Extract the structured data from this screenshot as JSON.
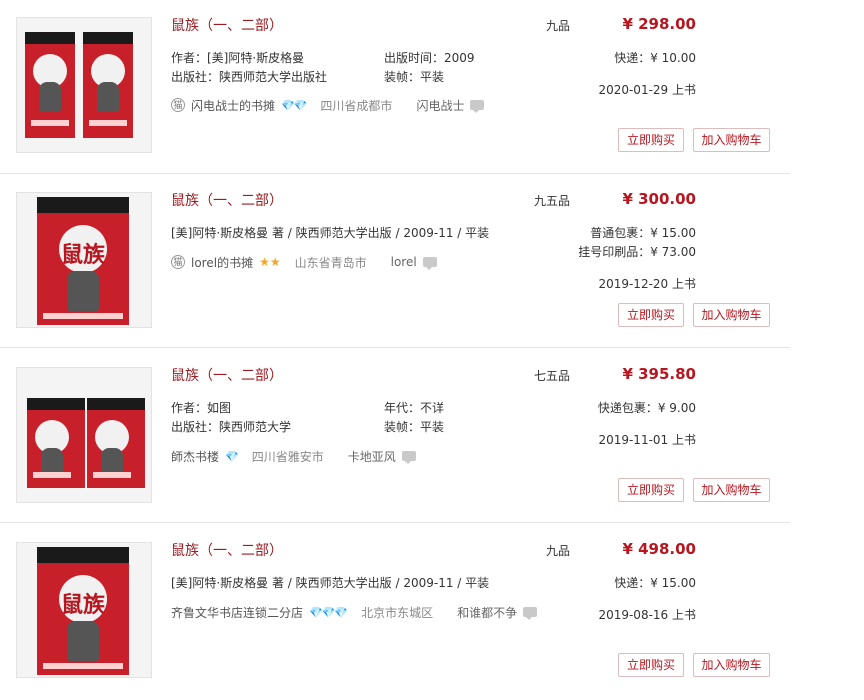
{
  "listings": [
    {
      "title": "鼠族（一、二部）",
      "grade": "九品",
      "price": "¥ 298.00",
      "meta_left_1": "作者：[美]阿特·斯皮格曼",
      "meta_left_2": "出版社：陕西师范大学出版社",
      "meta_right_1": "出版时间：2009",
      "meta_right_2": "装帧：平装",
      "shipping_1": "快递：¥ 10.00",
      "shipping_2": "",
      "date": "2020-01-29 上书",
      "seller_badge": "猫",
      "seller_name": "闪电战士的书摊",
      "seller_rating": "💎💎",
      "location": "四川省成都市",
      "nickname": "闪电战士",
      "buy_label": "立即购买",
      "cart_label": "加入购物车"
    },
    {
      "title": "鼠族（一、二部）",
      "grade": "九五品",
      "price": "¥ 300.00",
      "meta_line": "[美]阿特·斯皮格曼 著 / 陕西师范大学出版   / 2009-11 / 平装",
      "shipping_1": "普通包裹：¥ 15.00",
      "shipping_2": "挂号印刷品：¥ 73.00",
      "date": "2019-12-20 上书",
      "seller_badge": "猫",
      "seller_name": "lorel的书摊",
      "seller_rating": "★★",
      "location": "山东省青岛市",
      "nickname": "lorel",
      "buy_label": "立即购买",
      "cart_label": "加入购物车"
    },
    {
      "title": "鼠族（一、二部）",
      "grade": "七五品",
      "price": "¥ 395.80",
      "meta_left_1": "作者：如图",
      "meta_left_2": "出版社：陕西师范大学",
      "meta_right_1": "年代：不详",
      "meta_right_2": "装帧：平装",
      "shipping_1": "快递包裹：¥ 9.00",
      "shipping_2": "",
      "date": "2019-11-01 上书",
      "seller_badge": "",
      "seller_name": "師杰书楼",
      "seller_rating": "💎",
      "location": "四川省雅安市",
      "nickname": "卡地亚风",
      "buy_label": "立即购买",
      "cart_label": "加入购物车"
    },
    {
      "title": "鼠族（一、二部）",
      "grade": "九品",
      "price": "¥ 498.00",
      "meta_line": "[美]阿特·斯皮格曼 著 / 陕西师范大学出版   / 2009-11 / 平装",
      "shipping_1": "快递：¥ 15.00",
      "shipping_2": "",
      "date": "2019-08-16 上书",
      "seller_badge": "",
      "seller_name": "齐鲁文华书店连锁二分店",
      "seller_rating": "💎💎💎",
      "location": "北京市东城区",
      "nickname": "和谁都不争",
      "buy_label": "立即购买",
      "cart_label": "加入购物车"
    }
  ],
  "colors": {
    "accent": "#b8161f",
    "title": "#9b1c22",
    "diamond": "#31a4e2",
    "star": "#f5a623",
    "border": "#e6e6e6"
  }
}
